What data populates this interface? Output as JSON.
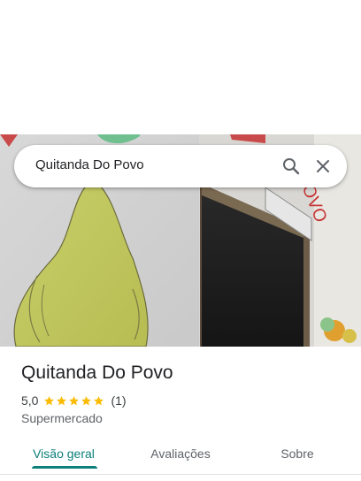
{
  "search": {
    "query": "Quitanda Do Povo"
  },
  "place": {
    "title": "Quitanda Do Povo",
    "rating": "5,0",
    "stars": 5,
    "reviews_count": "(1)",
    "category": "Supermercado"
  },
  "tabs": [
    {
      "label": "Visão geral",
      "active": true
    },
    {
      "label": "Avaliações",
      "active": false
    },
    {
      "label": "Sobre",
      "active": false
    }
  ],
  "colors": {
    "accent": "#0b7f79",
    "star": "#fbbc04"
  },
  "photo": {
    "sign_text": "POVO"
  }
}
